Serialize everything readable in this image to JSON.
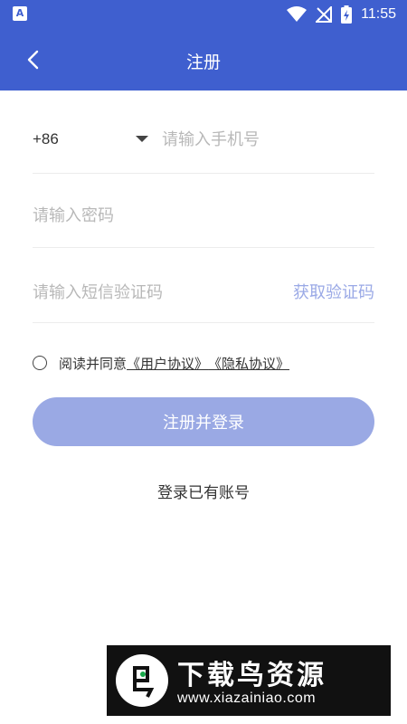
{
  "status_bar": {
    "time": "11:55",
    "notification_icon": "a-icon",
    "icons": [
      "wifi-icon",
      "signal-off-icon",
      "battery-charging-icon"
    ],
    "notification_letter": "A"
  },
  "header": {
    "title": "注册",
    "back_icon": "chevron-left-icon"
  },
  "form": {
    "country_code": "+86",
    "phone_placeholder": "请输入手机号",
    "password_placeholder": "请输入密码",
    "code_placeholder": "请输入短信验证码",
    "get_code_label": "获取验证码"
  },
  "agreement": {
    "prefix": "阅读并同意",
    "user_agreement": "《用户协议》",
    "privacy_agreement": "《隐私协议》"
  },
  "buttons": {
    "register_login": "注册并登录",
    "has_account_login": "登录已有账号"
  },
  "watermark": {
    "title": "下载鸟资源",
    "url": "www.xiazainiao.com"
  },
  "colors": {
    "primary": "#3f5fcf",
    "button_disabled": "#9aa9e4",
    "link_text": "#9aa9e6",
    "placeholder": "#b8b8b8"
  }
}
